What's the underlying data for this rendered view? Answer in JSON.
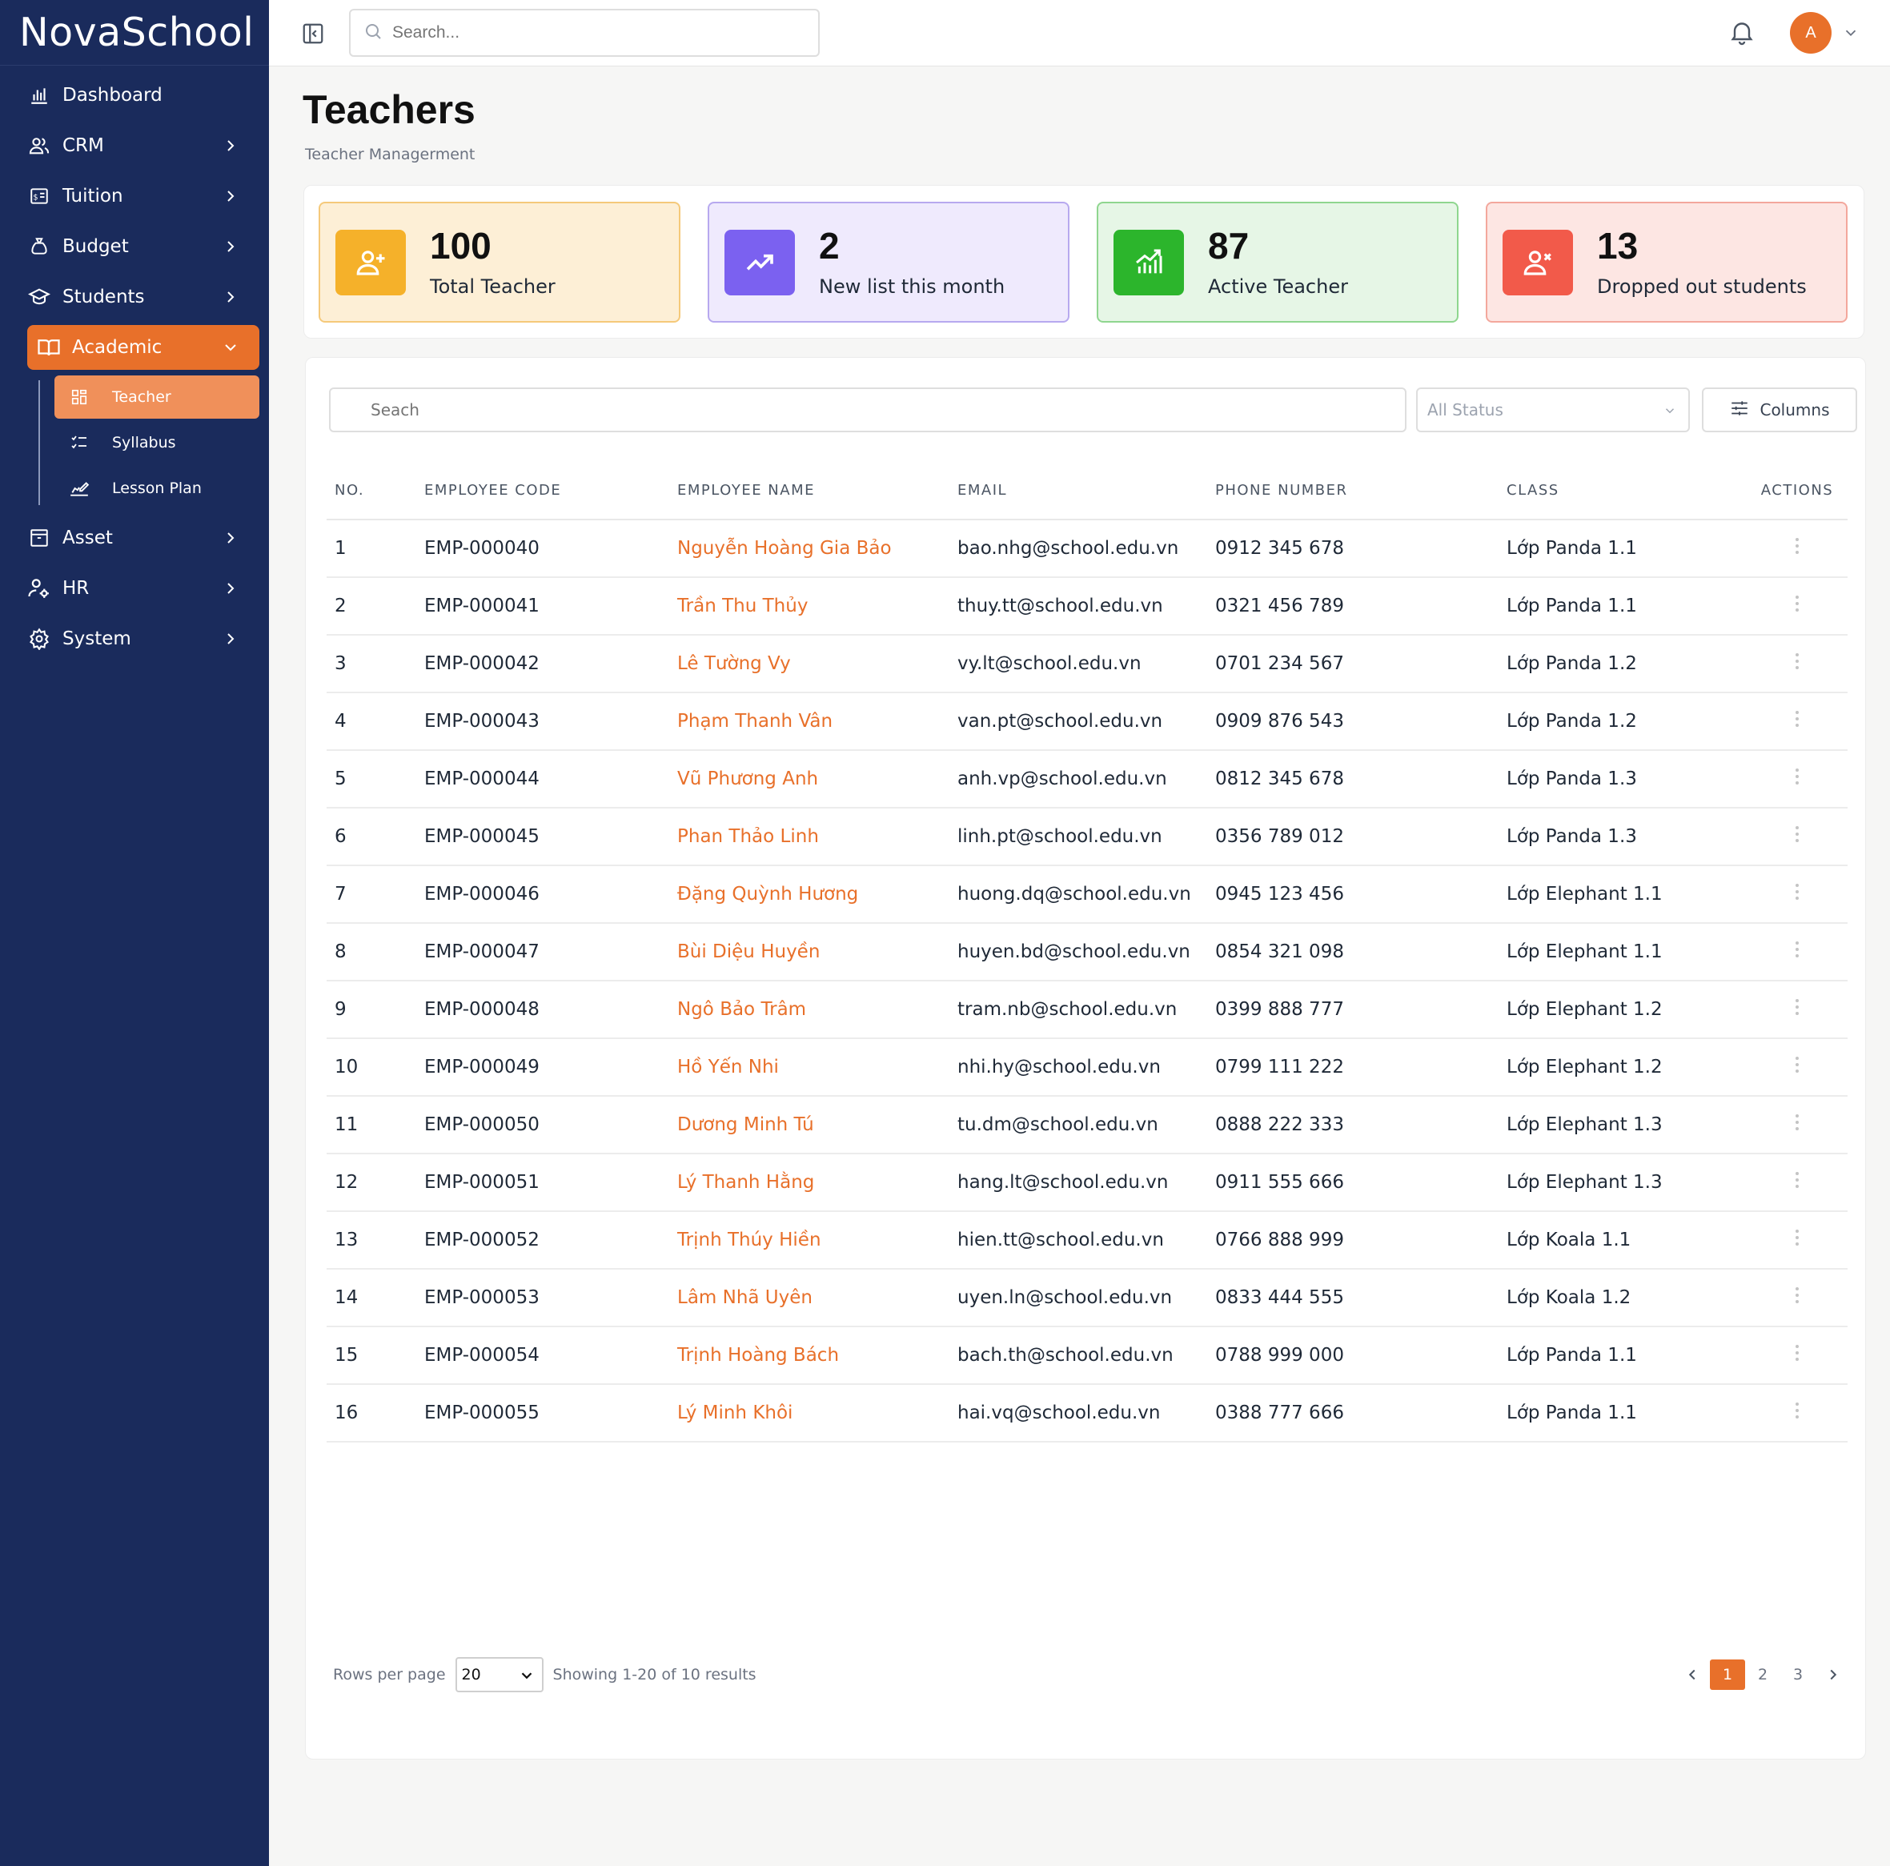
{
  "app": {
    "name": "NovaSchool"
  },
  "sidebar": {
    "items": [
      {
        "label": "Dashboard",
        "icon": "chart-bar-icon",
        "has_children": false
      },
      {
        "label": "CRM",
        "icon": "users-icon",
        "has_children": true
      },
      {
        "label": "Tuition",
        "icon": "invoice-icon",
        "has_children": true
      },
      {
        "label": "Budget",
        "icon": "money-bag-icon",
        "has_children": true
      },
      {
        "label": "Students",
        "icon": "graduation-cap-icon",
        "has_children": true
      },
      {
        "label": "Academic",
        "icon": "book-open-icon",
        "has_children": true,
        "expanded": true
      }
    ],
    "academic_sub": [
      {
        "label": "Teacher",
        "icon": "grid-icon",
        "active": true
      },
      {
        "label": "Syllabus",
        "icon": "checklist-icon",
        "active": false
      },
      {
        "label": "Lesson Plan",
        "icon": "hand-pencil-icon",
        "active": false
      }
    ],
    "items_after": [
      {
        "label": "Asset",
        "icon": "archive-icon",
        "has_children": true
      },
      {
        "label": "HR",
        "icon": "user-gear-icon",
        "has_children": true
      },
      {
        "label": "System",
        "icon": "gear-icon",
        "has_children": true
      }
    ]
  },
  "topbar": {
    "search_placeholder": "Search...",
    "avatar_initial": "A"
  },
  "page": {
    "title": "Teachers",
    "subtitle": "Teacher Managerment"
  },
  "stats": [
    {
      "value": "100",
      "label": "Total Teacher",
      "icon": "user-plus-icon",
      "bg": "#fdefd6",
      "border": "#f5c97a",
      "icon_bg": "#f5b12a"
    },
    {
      "value": "2",
      "label": "New list this month",
      "icon": "trending-up-icon",
      "bg": "#efeafd",
      "border": "#b7a9ef",
      "icon_bg": "#7b61f0"
    },
    {
      "value": "87",
      "label": "Active Teacher",
      "icon": "chart-growth-icon",
      "bg": "#e6f6e6",
      "border": "#8fd68f",
      "icon_bg": "#2cb52c"
    },
    {
      "value": "13",
      "label": "Dropped out students",
      "icon": "user-remove-icon",
      "bg": "#fde6e3",
      "border": "#f3a79c",
      "icon_bg": "#f25a4a"
    }
  ],
  "table": {
    "search_placeholder": "Seach",
    "status_filter": "All Status",
    "columns_button": "Columns",
    "headers": [
      "NO.",
      "EMPLOYEE CODE",
      "EMPLOYEE NAME",
      "EMAIL",
      "PHONE NUMBER",
      "CLASS",
      "ACTIONS"
    ],
    "rows": [
      {
        "no": "1",
        "code": "EMP-000040",
        "name": "Nguyễn Hoàng Gia Bảo",
        "email": "bao.nhg@school.edu.vn",
        "phone": "0912 345 678",
        "class": "Lớp Panda 1.1"
      },
      {
        "no": "2",
        "code": "EMP-000041",
        "name": "Trần Thu Thủy",
        "email": "thuy.tt@school.edu.vn",
        "phone": "0321 456 789",
        "class": "Lớp Panda 1.1"
      },
      {
        "no": "3",
        "code": "EMP-000042",
        "name": "Lê Tường Vy",
        "email": "vy.lt@school.edu.vn",
        "phone": "0701 234 567",
        "class": "Lớp Panda 1.2"
      },
      {
        "no": "4",
        "code": "EMP-000043",
        "name": "Phạm Thanh Vân",
        "email": "van.pt@school.edu.vn",
        "phone": "0909 876 543",
        "class": "Lớp Panda 1.2"
      },
      {
        "no": "5",
        "code": "EMP-000044",
        "name": "Vũ Phương Anh",
        "email": "anh.vp@school.edu.vn",
        "phone": "0812 345 678",
        "class": "Lớp Panda 1.3"
      },
      {
        "no": "6",
        "code": "EMP-000045",
        "name": "Phan Thảo Linh",
        "email": "linh.pt@school.edu.vn",
        "phone": "0356 789 012",
        "class": "Lớp Panda 1.3"
      },
      {
        "no": "7",
        "code": "EMP-000046",
        "name": "Đặng Quỳnh Hương",
        "email": "huong.dq@school.edu.vn",
        "phone": "0945 123 456",
        "class": "Lớp Elephant 1.1"
      },
      {
        "no": "8",
        "code": "EMP-000047",
        "name": "Bùi Diệu Huyền",
        "email": "huyen.bd@school.edu.vn",
        "phone": "0854 321 098",
        "class": "Lớp Elephant 1.1"
      },
      {
        "no": "9",
        "code": "EMP-000048",
        "name": "Ngô Bảo Trâm",
        "email": "tram.nb@school.edu.vn",
        "phone": "0399 888 777",
        "class": "Lớp Elephant 1.2"
      },
      {
        "no": "10",
        "code": "EMP-000049",
        "name": "Hồ Yến Nhi",
        "email": "nhi.hy@school.edu.vn",
        "phone": "0799 111 222",
        "class": "Lớp Elephant 1.2"
      },
      {
        "no": "11",
        "code": "EMP-000050",
        "name": "Dương Minh Tú",
        "email": "tu.dm@school.edu.vn",
        "phone": "0888 222 333",
        "class": "Lớp Elephant 1.3"
      },
      {
        "no": "12",
        "code": "EMP-000051",
        "name": "Lý Thanh Hằng",
        "email": "hang.lt@school.edu.vn",
        "phone": "0911 555 666",
        "class": "Lớp Elephant 1.3"
      },
      {
        "no": "13",
        "code": "EMP-000052",
        "name": "Trịnh Thúy Hiền",
        "email": "hien.tt@school.edu.vn",
        "phone": "0766 888 999",
        "class": "Lớp Koala 1.1"
      },
      {
        "no": "14",
        "code": "EMP-000053",
        "name": "Lâm Nhã Uyên",
        "email": "uyen.ln@school.edu.vn",
        "phone": "0833 444 555",
        "class": "Lớp Koala 1.2"
      },
      {
        "no": "15",
        "code": "EMP-000054",
        "name": "Trịnh Hoàng Bách",
        "email": "bach.th@school.edu.vn",
        "phone": "0788 999 000",
        "class": "Lớp Panda 1.1"
      },
      {
        "no": "16",
        "code": "EMP-000055",
        "name": "Lý Minh Khôi",
        "email": "hai.vq@school.edu.vn",
        "phone": "0388 777 666",
        "class": "Lớp Panda 1.1"
      }
    ]
  },
  "pagination": {
    "rows_per_page_label": "Rows per page",
    "rows_per_page_value": "20",
    "showing_text": "Showing 1-20 of 10 results",
    "pages": [
      "1",
      "2",
      "3"
    ],
    "current_page": "1"
  },
  "colors": {
    "accent": "#e8702a",
    "sidebar": "#1a2b5c"
  }
}
